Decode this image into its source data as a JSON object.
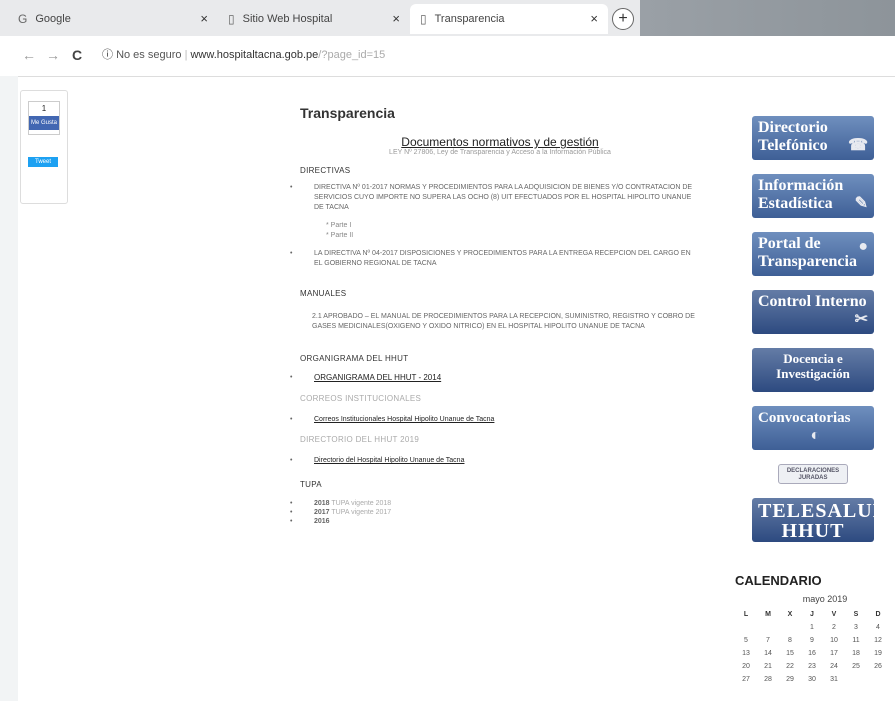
{
  "browser": {
    "tabs": [
      {
        "label": "Google",
        "icon": "google-icon",
        "close": "×"
      },
      {
        "label": "Sitio Web Hospital",
        "icon": "page-icon",
        "close": "×"
      },
      {
        "label": "Transparencia",
        "icon": "page-icon",
        "close": "×"
      }
    ],
    "new_tab": "+",
    "nav": {
      "back": "←",
      "forward": "→",
      "reload": "C"
    },
    "security": "No es seguro",
    "url_host": "www.hospitaltacna.gob.pe",
    "url_path": "/?page_id=15"
  },
  "share": {
    "like_count": "1",
    "like_label": "Me Gusta",
    "tweet_label": "Tweet"
  },
  "main": {
    "title": "Transparencia",
    "doc_title": "Documentos normativos y de gestión",
    "doc_subtitle": "LEY Nº 27806, Ley de Transparencia y Acceso a la Información Pública",
    "directivas_h": "DIRECTIVAS",
    "directiva1": "DIRECTIVA Nº 01-2017 NORMAS Y PROCEDIMIENTOS PARA LA ADQUISICION DE BIENES Y/O CONTRATACION DE SERVICIOS CUYO IMPORTE NO SUPERA LAS OCHO (8) UIT EFECTUADOS POR EL HOSPITAL HIPOLITO UNANUE DE TACNA",
    "parte1": "* Parte I",
    "parte2": "* Parte II",
    "directiva2": "LA DIRECTIVA Nº 04-2017 DISPOSICIONES Y PROCEDIMIENTOS PARA LA ENTREGA RECEPCION DEL CARGO EN EL GOBIERNO REGIONAL DE TACNA",
    "manuales_h": "MANUALES",
    "manual1": "2.1 APROBADO – EL MANUAL DE PROCEDIMIENTOS PARA LA RECEPCION, SUMINISTRO, REGISTRO Y COBRO DE GASES MEDICINALES(OXIGENO Y OXIDO NITRICO) EN EL HOSPITAL HIPOLITO UNANUE DE TACNA",
    "organigrama_h": "ORGANIGRAMA DEL HHUT",
    "organigrama_link": "ORGANIGRAMA DEL HHUT - 2014",
    "correos_h": "CORREOS INSTITUCIONALES",
    "correos_link": "Correos Institucionales Hospital Hipolito Unanue de Tacna",
    "directorio_h": "DIRECTORIO DEL HHUT 2019",
    "directorio_link": "Directorio del Hospital Hipolito Unanue de Tacna",
    "tupa_h": "TUPA",
    "tupa": [
      {
        "year": "2018",
        "note": "TUPA vigente 2018"
      },
      {
        "year": "2017",
        "note": "TUPA vigente 2017"
      },
      {
        "year": "2016",
        "note": ""
      }
    ]
  },
  "sidebar": [
    {
      "label": "Directorio Telefónico",
      "icon": "phone-icon",
      "glyph": "☎"
    },
    {
      "label": "Información Estadística",
      "icon": "chart-icon",
      "glyph": "✎"
    },
    {
      "label": "Portal de Transparencia",
      "icon": "globe-icon",
      "glyph": "●"
    },
    {
      "label": "Control Interno",
      "icon": "tools-icon",
      "glyph": "✂"
    },
    {
      "label": "Docencia e Investigación",
      "icon": "book-icon",
      "glyph": ""
    },
    {
      "label": "Convocatorias",
      "icon": "megaphone-icon",
      "glyph": "◐"
    },
    {
      "label": "DECLARACIONES JURADAS",
      "icon": "document-icon",
      "glyph": ""
    },
    {
      "label": "TELESALUD HHUT",
      "icon": "",
      "glyph": ""
    }
  ],
  "calendar": {
    "heading": "CALENDARIO",
    "month": "mayo 2019",
    "days": [
      "L",
      "M",
      "X",
      "J",
      "V",
      "S",
      "D"
    ],
    "weeks": [
      [
        "",
        "",
        "",
        "1",
        "2",
        "3",
        "4"
      ],
      [
        "5",
        "7",
        "8",
        "9",
        "10",
        "11",
        "12"
      ],
      [
        "13",
        "14",
        "15",
        "16",
        "17",
        "18",
        "19"
      ],
      [
        "20",
        "21",
        "22",
        "23",
        "24",
        "25",
        "26"
      ],
      [
        "27",
        "28",
        "29",
        "30",
        "31",
        "",
        ""
      ]
    ]
  }
}
